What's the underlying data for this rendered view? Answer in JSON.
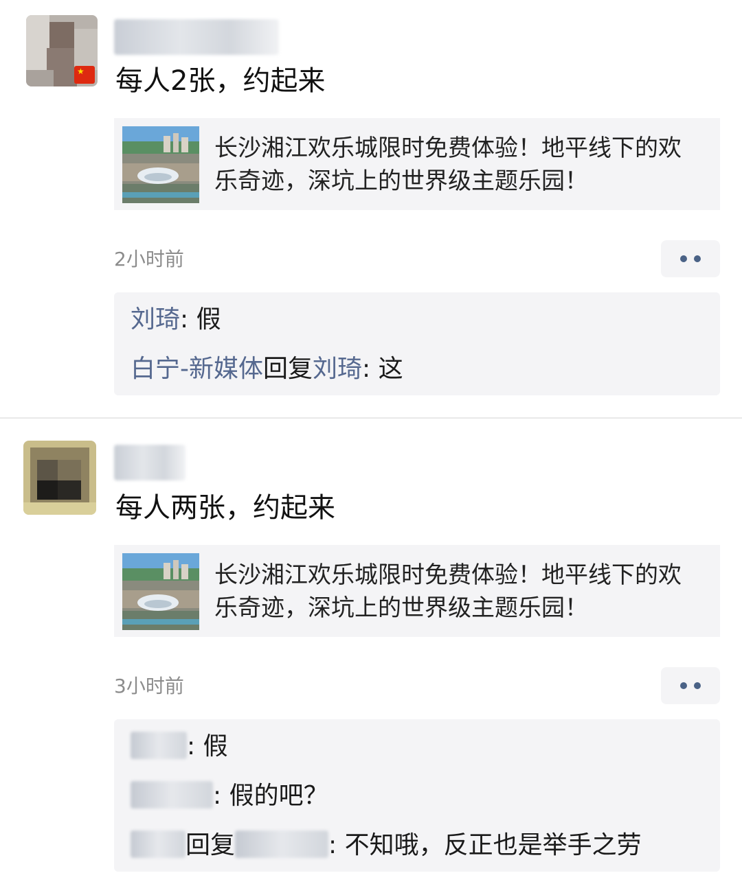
{
  "posts": [
    {
      "text": "每人2张，约起来",
      "flag_icon": "china-flag-icon",
      "link": {
        "title": "长沙湘江欢乐城限时免费体验！地平线下的欢乐奇迹，深坑上的世界级主题乐园！"
      },
      "time": "2小时前",
      "comments": [
        {
          "author": "刘琦",
          "sep": ": ",
          "text": "假"
        },
        {
          "author": "白宁-新媒体",
          "reply_word": "回复",
          "reply_to": "刘琦",
          "sep": ": ",
          "text": "这"
        }
      ]
    },
    {
      "text": "每人两张，约起来",
      "link": {
        "title": "长沙湘江欢乐城限时免费体验！地平线下的欢乐奇迹，深坑上的世界级主题乐园！"
      },
      "time": "3小时前",
      "comments": [
        {
          "sep": ": ",
          "text": "假"
        },
        {
          "sep": ": ",
          "text": "假的吧？"
        },
        {
          "reply_word": "回复",
          "sep": ": ",
          "text": "不知哦，反正也是举手之劳"
        }
      ]
    }
  ],
  "colors": {
    "nickname": "#55688f",
    "card_bg": "#f4f4f6",
    "time": "#8c8c8c"
  }
}
